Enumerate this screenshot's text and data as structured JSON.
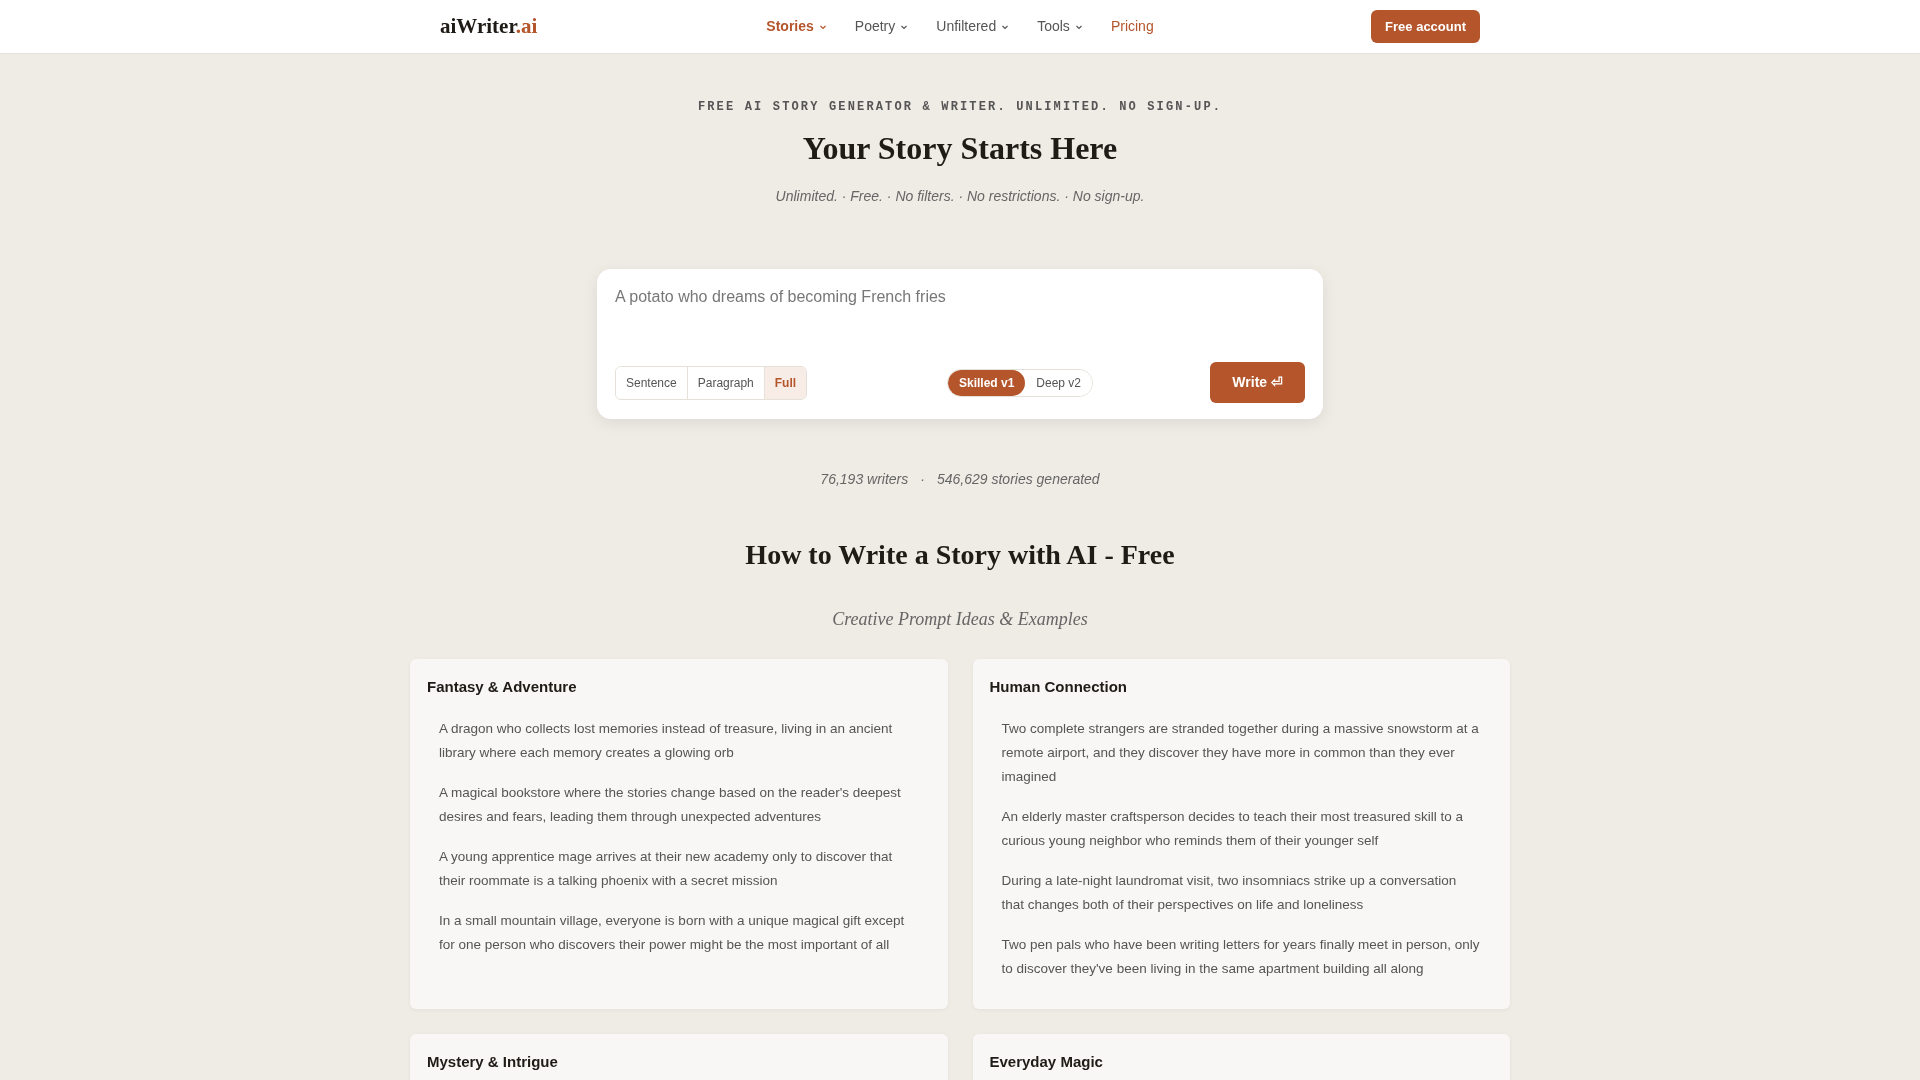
{
  "header": {
    "logo": {
      "name": "aiWriter",
      "suffix": ".ai"
    },
    "nav": [
      {
        "label": "Stories",
        "kind": "menu",
        "selected": true
      },
      {
        "label": "Poetry",
        "kind": "menu",
        "selected": false
      },
      {
        "label": "Unfiltered",
        "kind": "menu",
        "selected": false
      },
      {
        "label": "Tools",
        "kind": "menu",
        "selected": false
      },
      {
        "label": "Pricing",
        "kind": "link",
        "selected": false
      }
    ],
    "cta": "Free account"
  },
  "hero": {
    "eyebrow": "FREE AI STORY GENERATOR & WRITER. UNLIMITED. NO SIGN-UP.",
    "title": "Your Story Starts Here",
    "tagline": "Unlimited. · Free. · No filters. · No restrictions. · No sign-up."
  },
  "composer": {
    "placeholder": "A potato who dreams of becoming French fries",
    "lengths": [
      {
        "label": "Sentence",
        "selected": false
      },
      {
        "label": "Paragraph",
        "selected": false
      },
      {
        "label": "Full",
        "selected": true
      }
    ],
    "models": [
      {
        "label": "Skilled v1",
        "selected": true
      },
      {
        "label": "Deep v2",
        "selected": false
      }
    ],
    "submit": "Write ⏎"
  },
  "stats": [
    "76,193 writers",
    "·",
    "546,629 stories generated"
  ],
  "guide": {
    "title": "How to Write a Story with AI - Free",
    "subtitle": "Creative Prompt Ideas & Examples",
    "categories": [
      {
        "title": "Fantasy & Adventure",
        "prompts": [
          "A dragon who collects lost memories instead of treasure, living in an ancient library where each memory creates a glowing orb",
          "A magical bookstore where the stories change based on the reader's deepest desires and fears, leading them through unexpected adventures",
          "A young apprentice mage arrives at their new academy only to discover that their roommate is a talking phoenix with a secret mission",
          "In a small mountain village, everyone is born with a unique magical gift except for one person who discovers their power might be the most important of all"
        ]
      },
      {
        "title": "Human Connection",
        "prompts": [
          "Two complete strangers are stranded together during a massive snowstorm at a remote airport, and they discover they have more in common than they ever imagined",
          "An elderly master craftsperson decides to teach their most treasured skill to a curious young neighbor who reminds them of their younger self",
          "During a late-night laundromat visit, two insomniacs strike up a conversation that changes both of their perspectives on life and loneliness",
          "Two pen pals who have been writing letters for years finally meet in person, only to discover they've been living in the same apartment building all along"
        ]
      },
      {
        "title": "Mystery & Intrigue"
      },
      {
        "title": "Everyday Magic"
      }
    ]
  }
}
